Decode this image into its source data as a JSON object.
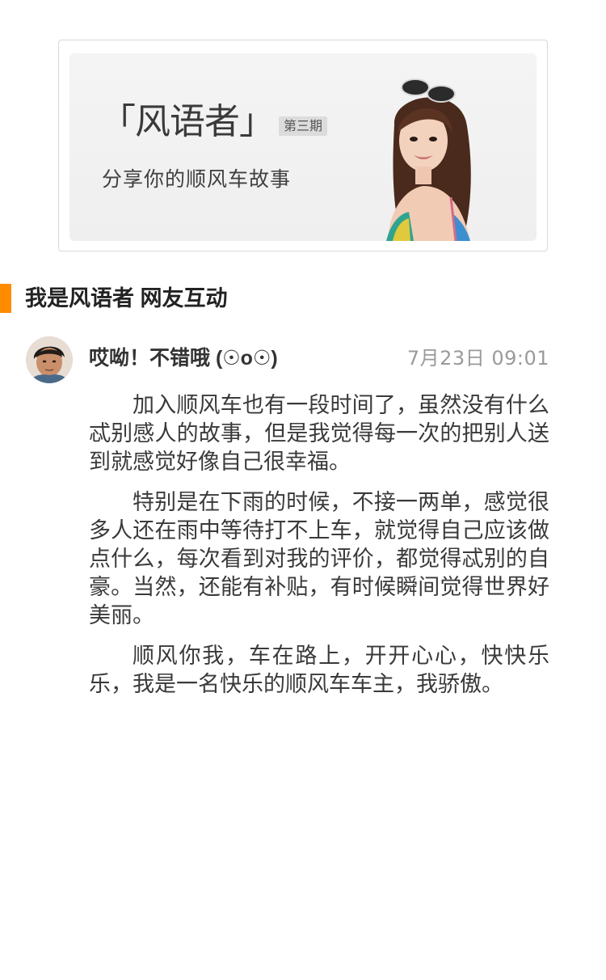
{
  "banner": {
    "title": "「风语者」",
    "issue": "第三期",
    "subtitle": "分享你的顺风车故事",
    "photo_icon": "woman-portrait-photo"
  },
  "section": {
    "title": "我是风语者 网友互动",
    "accent_color": "#ff8c00"
  },
  "comment": {
    "avatar_icon": "user-avatar-photo",
    "author": "哎呦！不错哦 (☉o☉)",
    "time": "7月23日 09:01",
    "paragraphs": [
      "加入顺风车也有一段时间了，虽然没有什么忒别感人的故事，但是我觉得每一次的把别人送到就感觉好像自己很幸福。",
      "特别是在下雨的时候，不接一两单，感觉很多人还在雨中等待打不上车，就觉得自己应该做点什么，每次看到对我的评价，都觉得忒别的自豪。当然，还能有补贴，有时候瞬间觉得世界好美丽。",
      "顺风你我，车在路上，开开心心，快快乐乐，我是一名快乐的顺风车车主，我骄傲。"
    ]
  }
}
